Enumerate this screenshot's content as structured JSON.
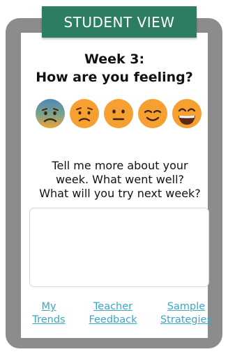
{
  "banner": {
    "label": "STUDENT VIEW",
    "color": "#2d7d62"
  },
  "heading": {
    "line1": "Week 3:",
    "line2": "How are you feeling?"
  },
  "mood_options": [
    {
      "name": "miserable-face-icon",
      "icon": "face-with-cold-sweat"
    },
    {
      "name": "sad-face-icon",
      "icon": "frowning-face"
    },
    {
      "name": "neutral-face-icon",
      "icon": "neutral-face"
    },
    {
      "name": "content-face-icon",
      "icon": "smiling-face-closed-eyes"
    },
    {
      "name": "happy-face-icon",
      "icon": "grinning-face"
    }
  ],
  "prompt": {
    "line1": "Tell me more about your",
    "line2": "week. What went well?",
    "line3": "What will you try next week?"
  },
  "response": {
    "value": "",
    "placeholder": ""
  },
  "links": {
    "my_trends": {
      "line1": "My",
      "line2": "Trends"
    },
    "teacher_feedback": {
      "line1": "Teacher",
      "line2": "Feedback"
    },
    "sample_strategies": {
      "line1": "Sample",
      "line2": "Strategies"
    }
  },
  "colors": {
    "frame": "#8c8c8c",
    "link": "#3aa6c8",
    "face_orange": "#f5a031"
  }
}
